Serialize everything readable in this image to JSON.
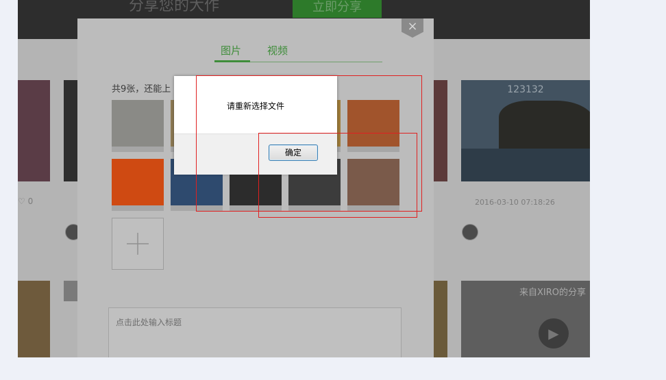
{
  "background_page": {
    "header_slogan": "分享您的大作",
    "header_share_button": "立即分享",
    "card_tag": "123132",
    "card_date": "2016-03-10 07:18:26",
    "like_count": "0",
    "bottom_card_source": "来自XIRO的分享"
  },
  "share_modal": {
    "close_glyph": "×",
    "tabs": [
      {
        "label": "图片",
        "active": true
      },
      {
        "label": "视频",
        "active": false
      }
    ],
    "count_text": "共9张，还能上",
    "thumbnails": [
      {
        "name": "koala",
        "color": "#8a8a86"
      },
      {
        "name": "hidden-2",
        "color": "#8d7a54"
      },
      {
        "name": "hidden-3",
        "color": "#7c6a4c"
      },
      {
        "name": "hidden-4",
        "color": "#a07c3a"
      },
      {
        "name": "desert",
        "color": "#a1542c"
      },
      {
        "name": "flower",
        "color": "#cf4a12"
      },
      {
        "name": "jellyfish",
        "color": "#2e4a6e"
      },
      {
        "name": "portrait-bw",
        "color": "#2c2c2c"
      },
      {
        "name": "penguins",
        "color": "#3c3c3c"
      },
      {
        "name": "girl-glasses",
        "color": "#7a5a4a"
      }
    ],
    "add_icon": "plus-icon",
    "title_placeholder": "点击此处输入标题"
  },
  "alert_dialog": {
    "message": "请重新选择文件",
    "ok_label": "确定"
  },
  "colors": {
    "accent_green": "#3f8d3a",
    "annotation_red": "#e02020",
    "dialog_button_border": "#3c7fb1"
  }
}
